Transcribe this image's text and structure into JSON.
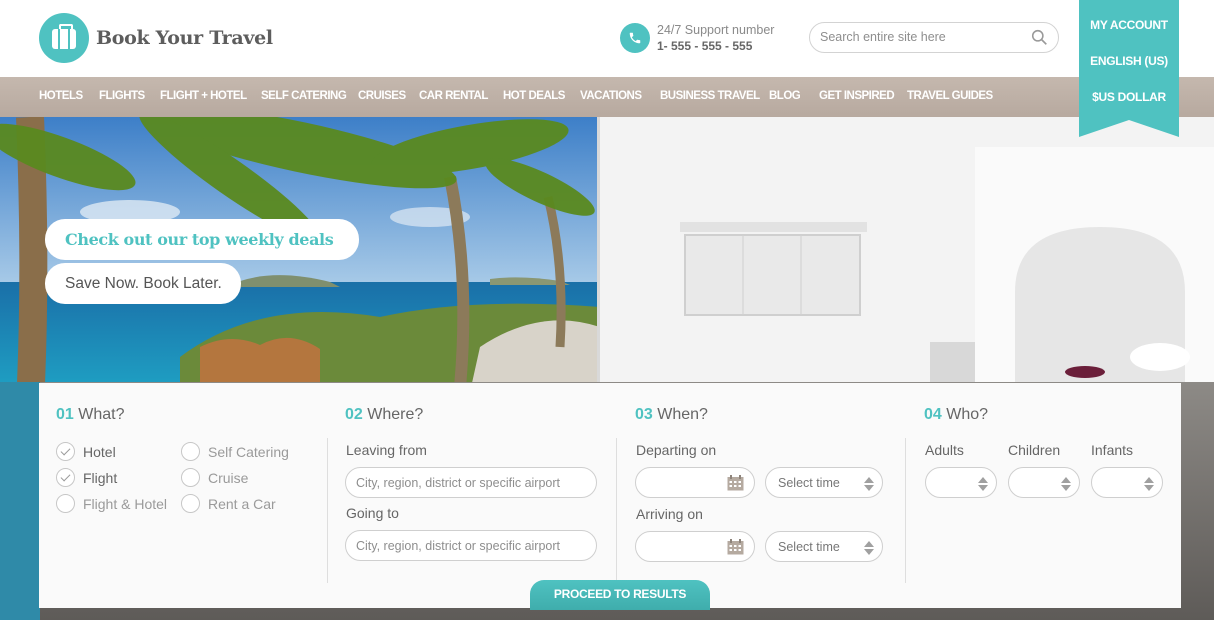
{
  "brand": {
    "name": "Book Your Travel"
  },
  "support": {
    "label": "24/7 Support number",
    "number": "1- 555 - 555 - 555"
  },
  "search": {
    "placeholder": "Search entire site here"
  },
  "account_menu": [
    "MY ACCOUNT",
    "ENGLISH (US)",
    "$US DOLLAR"
  ],
  "nav": [
    "HOTELS",
    "FLIGHTS",
    "FLIGHT + HOTEL",
    "SELF CATERING",
    "CRUISES",
    "CAR RENTAL",
    "HOT DEALS",
    "VACATIONS",
    "BUSINESS TRAVEL",
    "BLOG",
    "GET INSPIRED",
    "TRAVEL GUIDES"
  ],
  "hero": {
    "headline": "Check out our top weekly deals",
    "tagline": "Save Now. Book Later."
  },
  "booking": {
    "what": {
      "num": "01",
      "title": "What?",
      "options": [
        {
          "label": "Hotel",
          "checked": true
        },
        {
          "label": "Flight",
          "checked": true
        },
        {
          "label": "Flight & Hotel",
          "checked": false
        },
        {
          "label": "Self Catering",
          "checked": false
        },
        {
          "label": "Cruise",
          "checked": false
        },
        {
          "label": "Rent a Car",
          "checked": false
        }
      ]
    },
    "where": {
      "num": "02",
      "title": "Where?",
      "leaving_label": "Leaving from",
      "leaving_placeholder": "City, region, district or specific airport",
      "going_label": "Going to",
      "going_placeholder": "City, region, district or specific airport"
    },
    "when": {
      "num": "03",
      "title": "When?",
      "departing_label": "Departing on",
      "arriving_label": "Arriving on",
      "time_placeholder": "Select time"
    },
    "who": {
      "num": "04",
      "title": "Who?",
      "adults_label": "Adults",
      "children_label": "Children",
      "infants_label": "Infants"
    },
    "proceed_label": "PROCEED TO RESULTS"
  },
  "colors": {
    "accent": "#4fc2c1",
    "nav_bg": "#bcaea4"
  }
}
